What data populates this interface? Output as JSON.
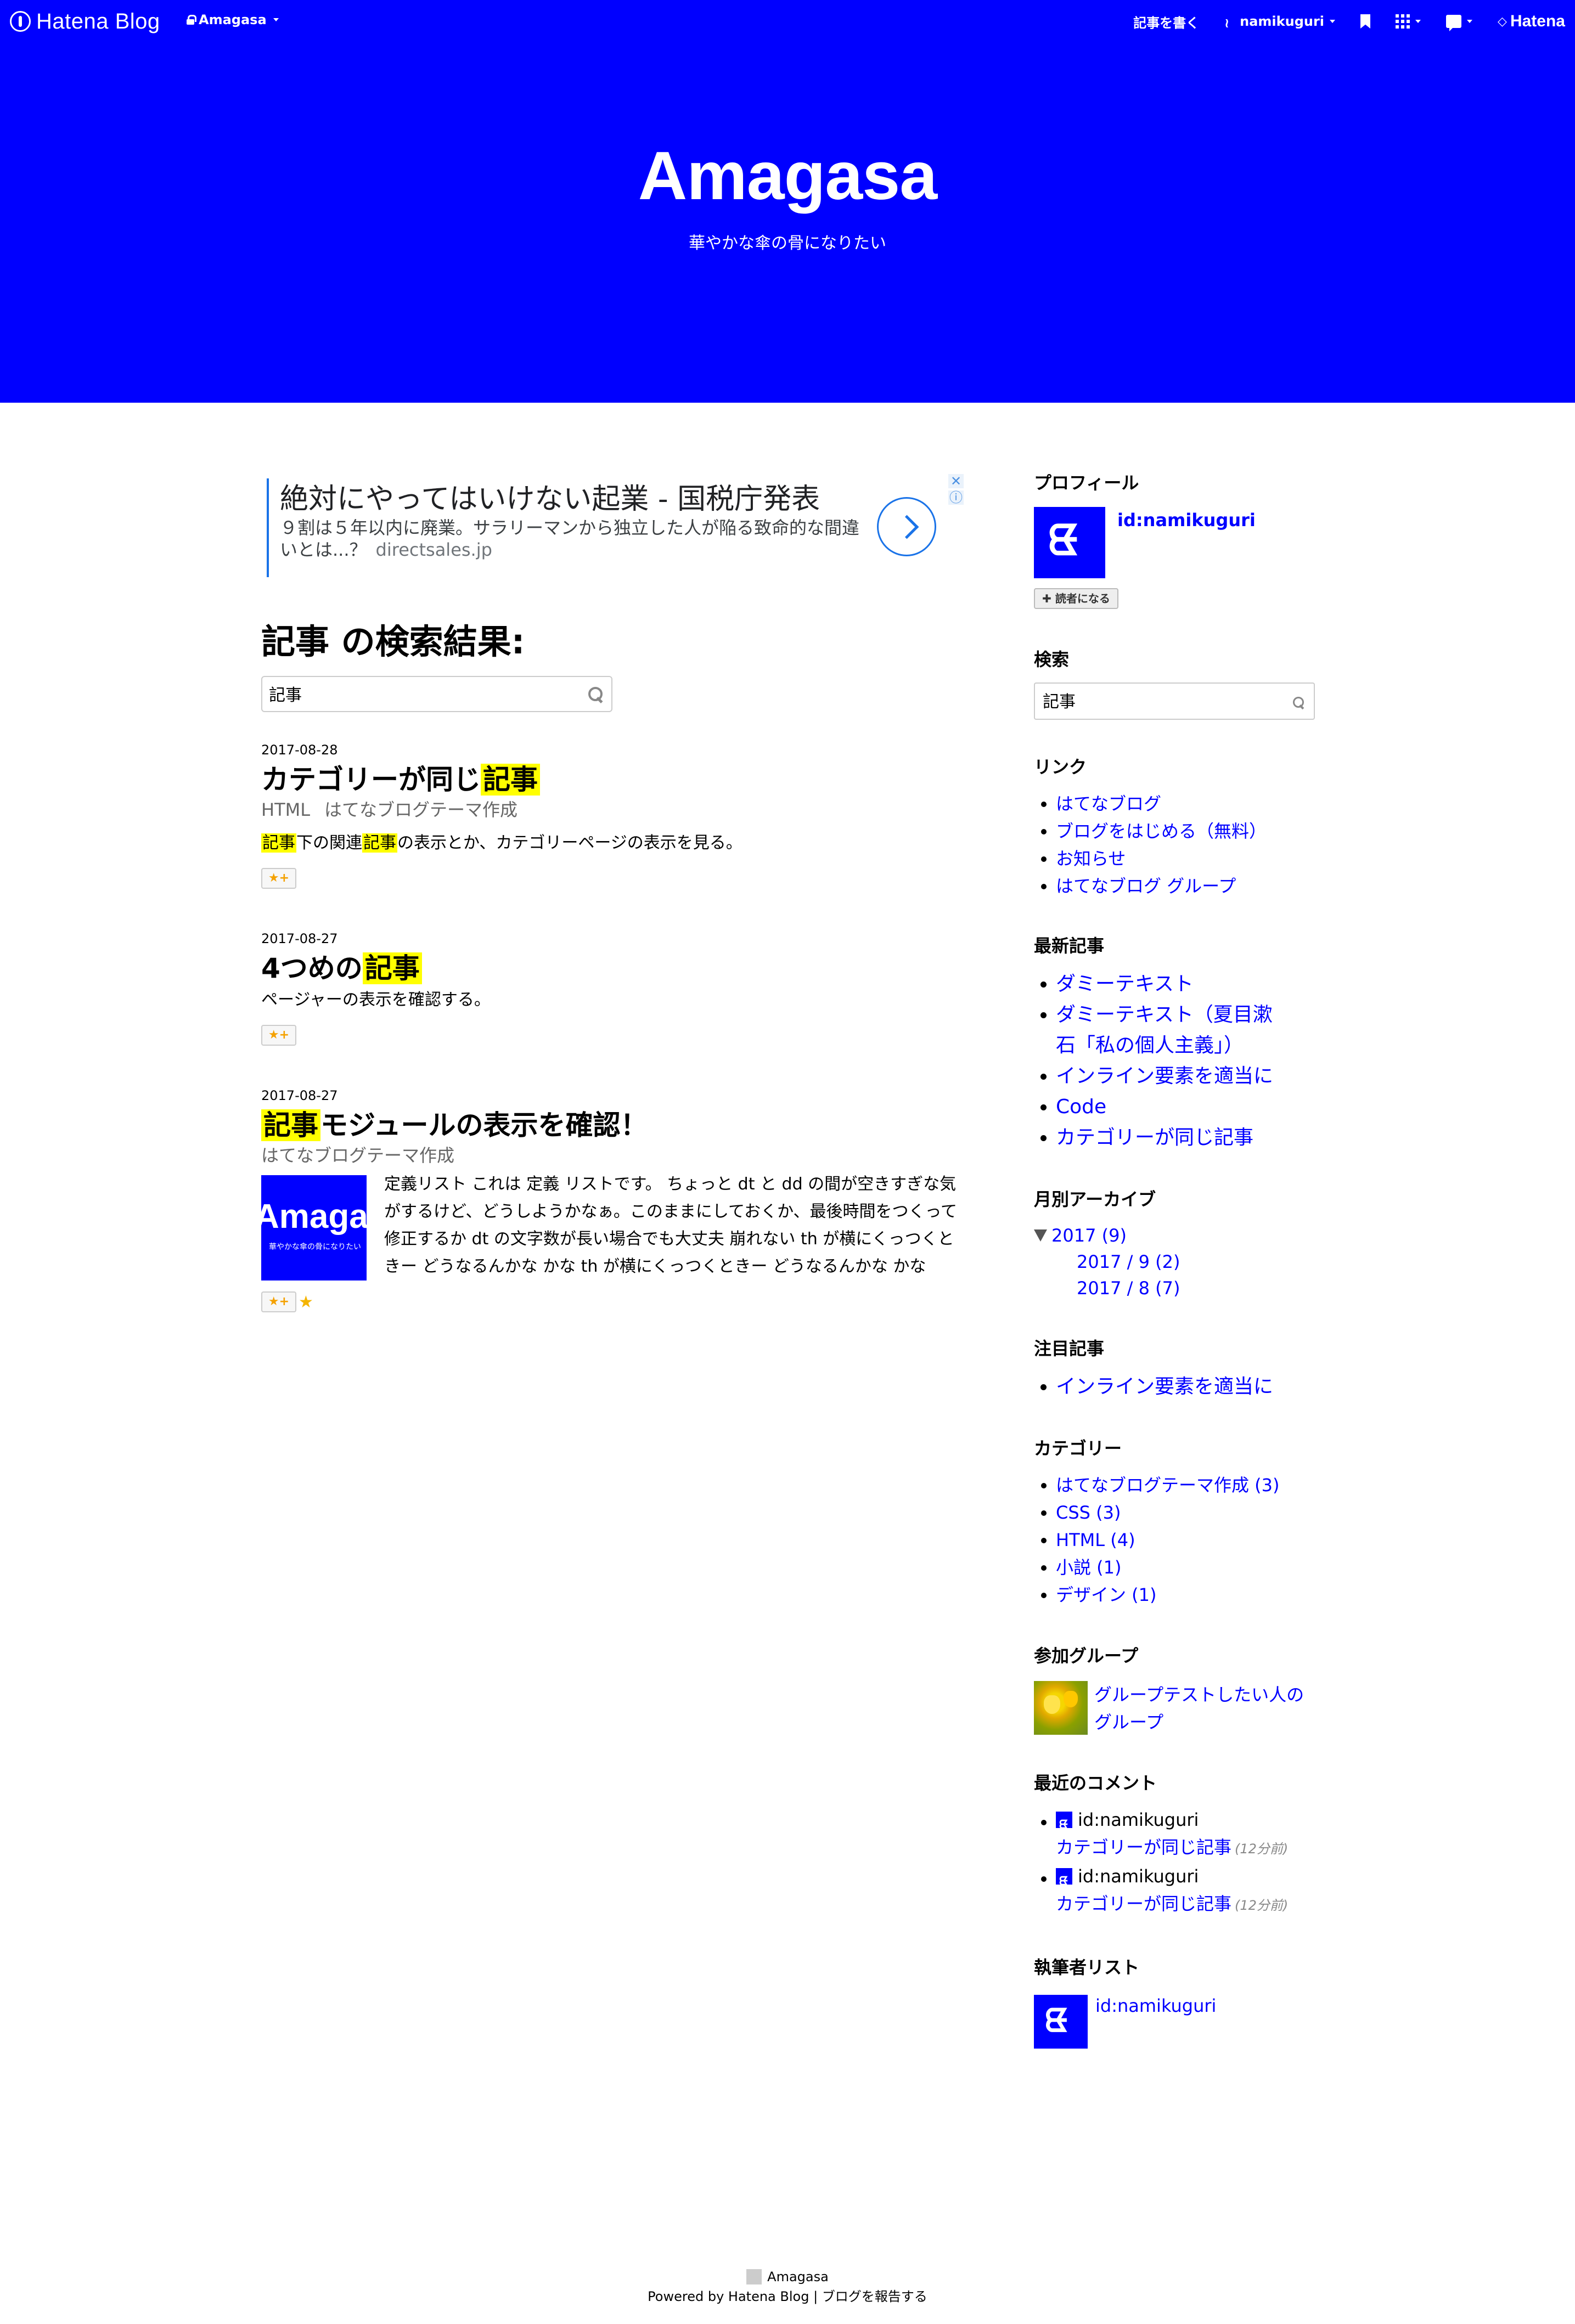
{
  "globalheader": {
    "logo_text": "Hatena Blog",
    "blog_name": "Amagasa",
    "write_label": "記事を書く",
    "user_name": "namikuguri",
    "hatena_label": "Hatena"
  },
  "blog": {
    "title": "Amagasa",
    "description": "華やかな傘の骨になりたい"
  },
  "ad": {
    "title": "絶対にやってはいけない起業 - 国税庁発表",
    "text": "９割は５年以内に廃業。サラリーマンから独立した人が陥る致命的な間違いとは...？",
    "url": "directsales.jp",
    "close_glyph": "✕",
    "info_glyph": "ⓘ"
  },
  "search": {
    "heading": "記事 の検索結果:",
    "query": "記事"
  },
  "entries": [
    {
      "date": "2017-08-28",
      "title_plain": "カテゴリーが同じ",
      "title_hl": "記事",
      "categories": [
        "HTML",
        "はてなブログテーマ作成"
      ],
      "summary_hl1": "記事",
      "summary_mid1": "下の関連",
      "summary_hl2": "記事",
      "summary_rest": "の表示とか、カテゴリーページの表示を見る。",
      "star_label": "★+"
    },
    {
      "date": "2017-08-27",
      "title_plain": "4つめの",
      "title_hl": "記事",
      "summary": "ページャーの表示を確認する。",
      "star_label": "★+"
    },
    {
      "date": "2017-08-27",
      "title_hl": "記事",
      "title_plain": "モジュールの表示を確認！",
      "categories": [
        "はてなブログテーマ作成"
      ],
      "thumb_title": "Amagasa",
      "thumb_sub": "華やかな傘の骨になりたい",
      "summary": "定義リスト これは 定義 リストです。 ちょっと dt と dd の間が空きすぎな気がするけど、どうしようかなぁ。このままにしておくか、最後時間をつくって修正するか dt の文字数が長い場合でも大丈夫 崩れない th が横にくっつくときー どうなるんかな かな th が横にくっつくときー どうなるんかな かな",
      "star_label": "★+",
      "star_extra": "★"
    }
  ],
  "sidebar": {
    "profile": {
      "title": "プロフィール",
      "id": "id:namikuguri",
      "subscribe": "✚ 読者になる"
    },
    "search": {
      "title": "検索",
      "query": "記事"
    },
    "links": {
      "title": "リンク",
      "items": [
        "はてなブログ",
        "ブログをはじめる（無料）",
        "お知らせ",
        "はてなブログ グループ"
      ]
    },
    "recent": {
      "title": "最新記事",
      "items": [
        "ダミーテキスト",
        "ダミーテキスト（夏目漱石「私の個人主義」）",
        "インライン要素を適当に",
        "Code",
        "カテゴリーが同じ記事"
      ]
    },
    "archive": {
      "title": "月別アーカイブ",
      "year": "2017 (9)",
      "months": [
        "2017 / 9 (2)",
        "2017 / 8 (7)"
      ]
    },
    "popular": {
      "title": "注目記事",
      "items": [
        "インライン要素を適当に"
      ]
    },
    "categories": {
      "title": "カテゴリー",
      "items": [
        "はてなブログテーマ作成 (3)",
        "CSS (3)",
        "HTML (4)",
        "小説 (1)",
        "デザイン (1)"
      ]
    },
    "groups": {
      "title": "参加グループ",
      "name": "グループテストしたい人のグループ"
    },
    "comments": {
      "title": "最近のコメント",
      "items": [
        {
          "user": "id:namikuguri",
          "entry": "カテゴリーが同じ記事",
          "time": "(12分前)"
        },
        {
          "user": "id:namikuguri",
          "entry": "カテゴリーが同じ記事",
          "time": "(12分前)"
        }
      ]
    },
    "authors": {
      "title": "執筆者リスト",
      "name": "id:namikuguri"
    }
  },
  "footer": {
    "blog_name": "Amagasa",
    "powered": "Powered by Hatena Blog",
    "separator": "|",
    "report": "ブログを報告する"
  },
  "colors": {
    "brand": "#0000ff",
    "highlight": "#ffff00",
    "star": "#f4a100"
  },
  "icons": [
    "hatena-blog-logo-icon",
    "lock-icon",
    "user-icon",
    "bookmark-icon",
    "apps-grid-icon",
    "notification-bubble-icon",
    "hatena-logo-icon",
    "search-icon",
    "arrow-right-icon",
    "close-icon",
    "info-icon",
    "star-icon",
    "triangle-down-icon"
  ]
}
